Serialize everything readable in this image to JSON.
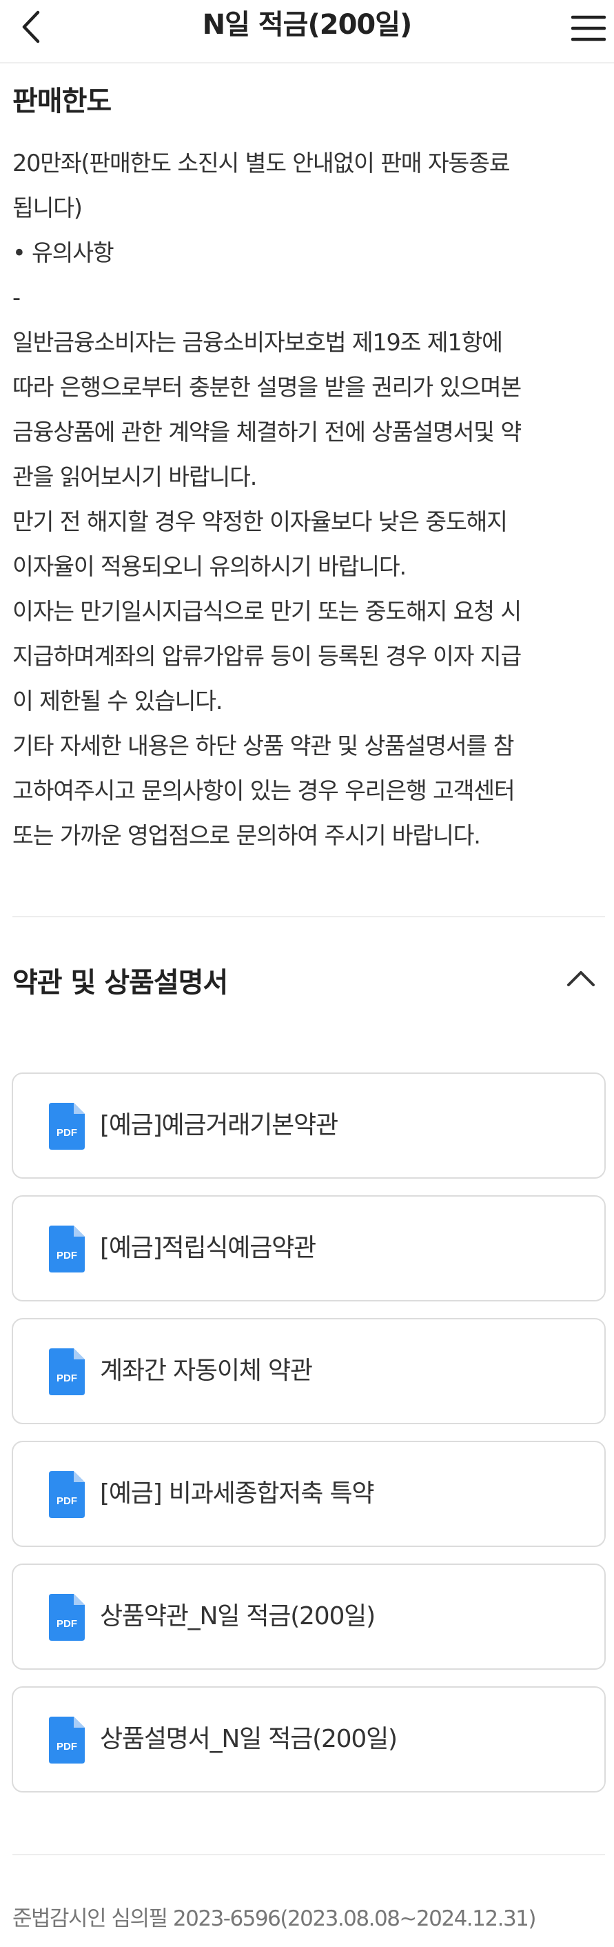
{
  "header": {
    "title": "N일 적금(200일)",
    "back_icon": "chevron-left-icon",
    "menu_icon": "hamburger-menu-icon"
  },
  "sales_limit": {
    "heading": "판매한도",
    "lines": [
      "20만좌(판매한도 소진시 별도 안내없이 판매 자동종료",
      "됩니다)",
      "• 유의사항",
      "-",
      "일반금융소비자는 금융소비자보호법 제19조 제1항에",
      "따라 은행으로부터 충분한 설명을 받을 권리가 있으며본",
      "금융상품에 관한 계약을 체결하기 전에 상품설명서및 약",
      "관을 읽어보시기 바랍니다.",
      "만기 전 해지할 경우 약정한 이자율보다 낮은 중도해지",
      "이자율이 적용되오니 유의하시기 바랍니다.",
      "이자는 만기일시지급식으로 만기 또는 중도해지 요청 시",
      "지급하며계좌의 압류가압류 등이 등록된 경우 이자 지급",
      "이 제한될 수 있습니다.",
      "기타 자세한 내용은 하단 상품 약관 및 상품설명서를 참",
      "고하여주시고 문의사항이 있는 경우 우리은행 고객센터",
      "또는 가까운 영업점으로 문의하여 주시기 바랍니다."
    ]
  },
  "terms": {
    "heading": "약관 및 상품설명서",
    "toggle_icon": "chevron-up-icon",
    "pdf_icon_label": "PDF",
    "documents": [
      "[예금]예금거래기본약관",
      "[예금]적립식예금약관",
      "계좌간 자동이체 약관",
      "[예금] 비과세종합저축 특약",
      "상품약관_N일 적금(200일)",
      "상품설명서_N일 적금(200일)"
    ]
  },
  "footer": {
    "compliance": "준법감시인 심의필 2023-6596(2023.08.08~2024.12.31)"
  },
  "colors": {
    "pdf_blue": "#2d8cf0",
    "border": "#dcdcdc",
    "divider": "#ededed"
  }
}
